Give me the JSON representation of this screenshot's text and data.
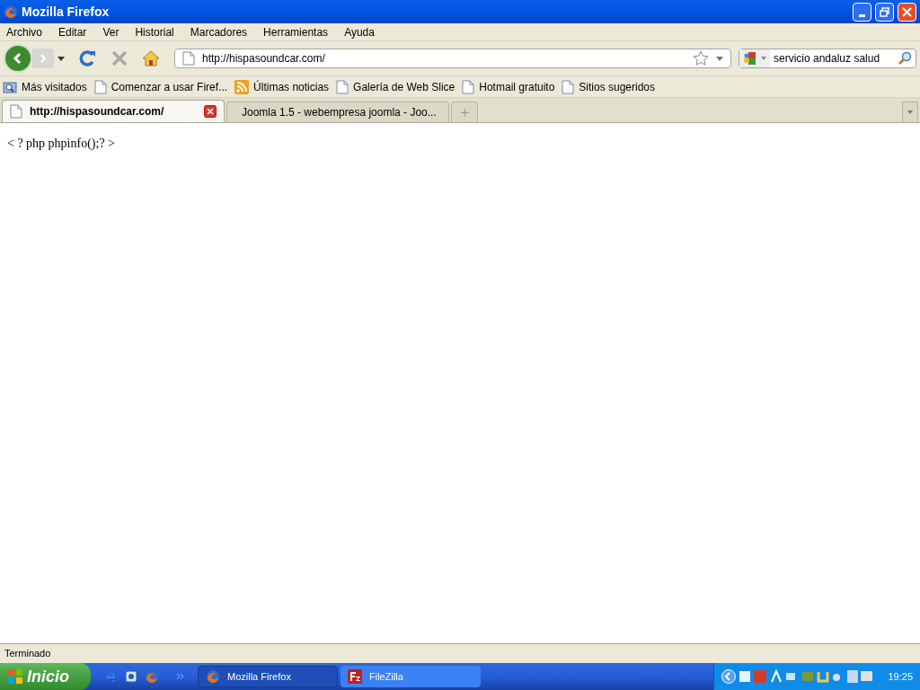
{
  "window": {
    "title": "Mozilla Firefox"
  },
  "menu": [
    "Archivo",
    "Editar",
    "Ver",
    "Historial",
    "Marcadores",
    "Herramientas",
    "Ayuda"
  ],
  "address": {
    "value": "http://hispasoundcar.com/"
  },
  "search": {
    "value": "servicio andaluz salud"
  },
  "bookmarks": [
    {
      "label": "Más visitados",
      "kind": "smart"
    },
    {
      "label": "Comenzar a usar Firef...",
      "kind": "page"
    },
    {
      "label": "Últimas noticias",
      "kind": "feed"
    },
    {
      "label": "Galería de Web Slice",
      "kind": "page"
    },
    {
      "label": "Hotmail gratuito",
      "kind": "page"
    },
    {
      "label": "Sitios sugeridos",
      "kind": "page"
    }
  ],
  "tabs": [
    {
      "label": "http://hispasoundcar.com/",
      "selected": true,
      "kind": "page"
    },
    {
      "label": "Joomla 1.5 - webempresa joomla - Joo...",
      "selected": false,
      "kind": "joomla"
    }
  ],
  "page": {
    "text": "< ? php phpinfo();? >"
  },
  "status_bar": {
    "text": "Terminado"
  },
  "taskbar": {
    "start": "Inicio",
    "tasks": [
      {
        "label": "Mozilla Firefox",
        "selected": true,
        "kind": "firefox"
      },
      {
        "label": "FileZilla",
        "selected": false,
        "kind": "filezilla"
      }
    ],
    "clock": "19:25"
  }
}
